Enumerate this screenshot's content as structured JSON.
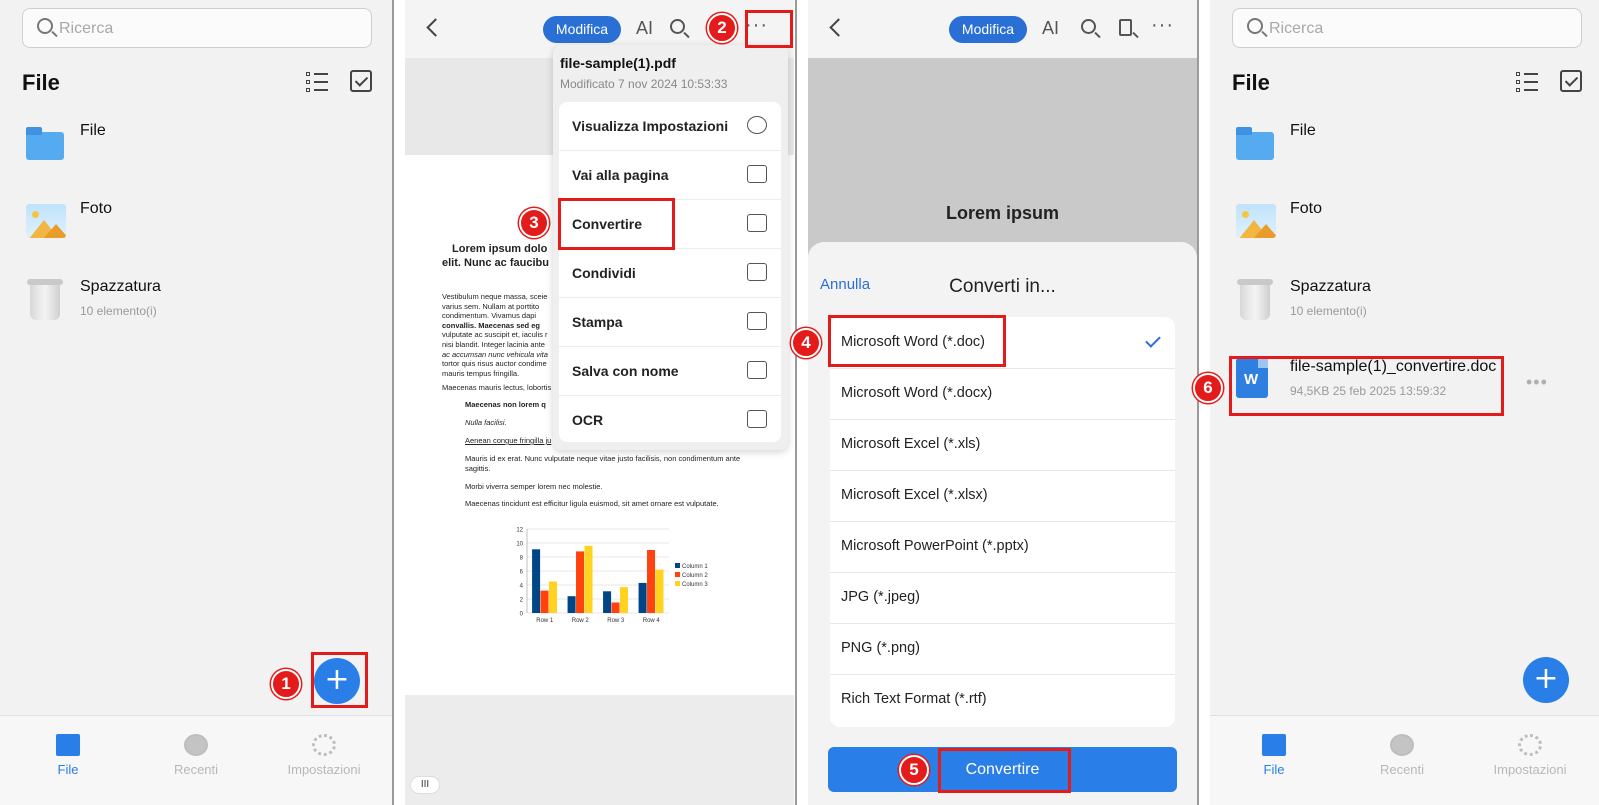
{
  "panel1": {
    "search_placeholder": "Ricerca",
    "title": "File",
    "items": [
      {
        "name": "File",
        "sub": ""
      },
      {
        "name": "Foto",
        "sub": ""
      },
      {
        "name": "Spazzatura",
        "sub": "10 elemento(i)"
      }
    ],
    "fab": "+",
    "nav": [
      "File",
      "Recenti",
      "Impostazioni"
    ]
  },
  "panel2": {
    "modifica": "Modifica",
    "ai": "AI",
    "more": "···",
    "menu_title": "file-sample(1).pdf",
    "menu_sub": "Modificato 7 nov 2024 10:53:33",
    "menu_items": [
      "Visualizza Impostazioni",
      "Vai alla pagina",
      "Convertire",
      "Condividi",
      "Stampa",
      "Salva con nome",
      "OCR"
    ],
    "pdf_heading": "Lorem ipsum dolo",
    "pdf_heading2": "elit. Nunc ac faucibu",
    "pdf_lines": [
      "Vestibulum neque massa, sceie",
      "varius sem. Nullam at porttito",
      "condimentum. Vivamus dapi",
      "convallis. Maecenas sed eg",
      "vulputate ac suscipit et, iaculis r",
      "nisi blandit. Integer lacinia ante",
      "ac accumsan nunc vehicula vita",
      "tortor quis risus auctor condime",
      "mauris tempus fringilla."
    ],
    "pdf_para2": "Maecenas mauris lectus, lobortis",
    "pdf_bullets": [
      "Maecenas non lorem q",
      "Nulla facilisi.",
      "Aenean congue fringilla ju",
      "Mauris id ex erat. Nunc vulputate neque vitae justo facilisis, non condimentum ante",
      "sagittis.",
      "Morbi viverra semper lorem nec molestie.",
      "Maecenas tincidunt est efficitur ligula euismod, sit amet ornare est vulputate."
    ],
    "homebar": "III"
  },
  "panel3": {
    "modifica": "Modifica",
    "ai": "AI",
    "more": "···",
    "doc_title": "Lorem ipsum",
    "cancel": "Annulla",
    "sheet_title": "Converti in...",
    "options": [
      "Microsoft Word (*.doc)",
      "Microsoft Word (*.docx)",
      "Microsoft Excel (*.xls)",
      "Microsoft Excel (*.xlsx)",
      "Microsoft PowerPoint (*.pptx)",
      "JPG (*.jpeg)",
      "PNG (*.png)",
      "Rich Text Format (*.rtf)"
    ],
    "convert": "Convertire"
  },
  "panel4": {
    "search_placeholder": "Ricerca",
    "title": "File",
    "items": [
      {
        "name": "File",
        "sub": ""
      },
      {
        "name": "Foto",
        "sub": ""
      },
      {
        "name": "Spazzatura",
        "sub": "10 elemento(i)"
      },
      {
        "name": "file-sample(1)_convertire.doc",
        "sub": "94,5KB 25 feb 2025 13:59:32"
      }
    ],
    "doc_icon_letter": "W",
    "fab": "+",
    "nav": [
      "File",
      "Recenti",
      "Impostazioni"
    ]
  },
  "badges": [
    "1",
    "2",
    "3",
    "4",
    "5",
    "6"
  ],
  "chart_data": {
    "type": "bar",
    "categories": [
      "Row 1",
      "Row 2",
      "Row 3",
      "Row 4"
    ],
    "series": [
      {
        "name": "Column 1",
        "values": [
          9.1,
          2.4,
          3.1,
          4.3
        ]
      },
      {
        "name": "Column 2",
        "values": [
          3.2,
          8.8,
          1.5,
          9.0
        ]
      },
      {
        "name": "Column 3",
        "values": [
          4.5,
          9.6,
          3.7,
          6.2
        ]
      }
    ],
    "yticks": [
      "0",
      "2",
      "4",
      "6",
      "8",
      "10",
      "12"
    ],
    "ylim": [
      0,
      12
    ],
    "legend": "right",
    "colors": [
      "#004586",
      "#ff420e",
      "#ffd320"
    ]
  },
  "colors": {
    "accent": "#2a7ee8",
    "annotation": "#e31b1b"
  }
}
